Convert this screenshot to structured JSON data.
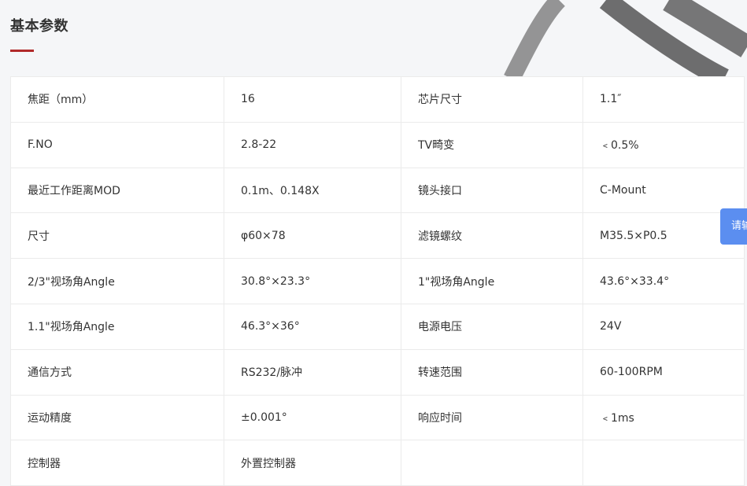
{
  "section": {
    "title": "基本参数"
  },
  "specs": {
    "rows": [
      {
        "label1": "焦距（mm）",
        "value1": "16",
        "label2": "芯片尺寸",
        "value2": "1.1″"
      },
      {
        "label1": "F.NO",
        "value1": "2.8-22",
        "label2": "TV畸变",
        "value2": "﹤0.5%"
      },
      {
        "label1": "最近工作距离MOD",
        "value1": "0.1m、0.148X",
        "label2": "镜头接口",
        "value2": "C-Mount"
      },
      {
        "label1": "尺寸",
        "value1": "φ60×78",
        "label2": "滤镜螺纹",
        "value2": "M35.5×P0.5"
      },
      {
        "label1": "2/3\"视场角Angle",
        "value1": "30.8°×23.3°",
        "label2": "1\"视场角Angle",
        "value2": "43.6°×33.4°"
      },
      {
        "label1": "1.1\"视场角Angle",
        "value1": "46.3°×36°",
        "label2": "电源电压",
        "value2": "24V"
      },
      {
        "label1": "通信方式",
        "value1": "RS232/脉冲",
        "label2": "转速范围",
        "value2": "60-100RPM"
      },
      {
        "label1": "运动精度",
        "value1": "±0.001°",
        "label2": "响应时间",
        "value2": "﹤1ms"
      },
      {
        "label1": "控制器",
        "value1": "外置控制器",
        "label2": "",
        "value2": ""
      }
    ]
  },
  "float_tab": {
    "label": "请输"
  }
}
